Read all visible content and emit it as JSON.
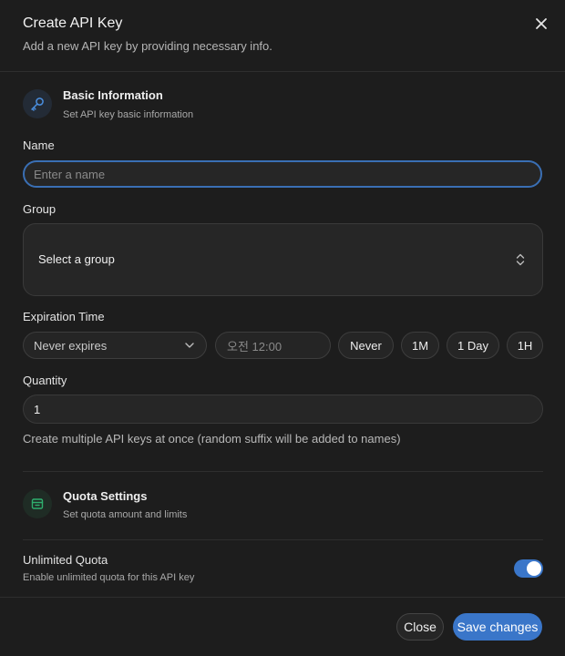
{
  "dialog": {
    "title": "Create API Key",
    "subtitle": "Add a new API key by providing necessary info."
  },
  "basic_section": {
    "icon": "key-icon",
    "title": "Basic Information",
    "subtitle": "Set API key basic information"
  },
  "name_field": {
    "label": "Name",
    "value": "",
    "placeholder": "Enter a name"
  },
  "group_field": {
    "label": "Group",
    "value": "Select a group"
  },
  "expiration": {
    "label": "Expiration Time",
    "select_value": "Never expires",
    "time_value": "오전 12:00",
    "presets": [
      "Never",
      "1M",
      "1 Day",
      "1H"
    ]
  },
  "quantity": {
    "label": "Quantity",
    "value": "1",
    "help": "Create multiple API keys at once (random suffix will be added to names)"
  },
  "quota_section": {
    "icon": "wallet-icon",
    "title": "Quota Settings",
    "subtitle": "Set quota amount and limits"
  },
  "unlimited_quota": {
    "label": "Unlimited Quota",
    "description": "Enable unlimited quota for this API key",
    "enabled": true
  },
  "footer": {
    "close_label": "Close",
    "save_label": "Save changes"
  },
  "colors": {
    "accent": "#3a76c9",
    "background": "#1d1d1d",
    "quota_icon": "#2fae6e",
    "key_icon": "#4a8fe0"
  }
}
